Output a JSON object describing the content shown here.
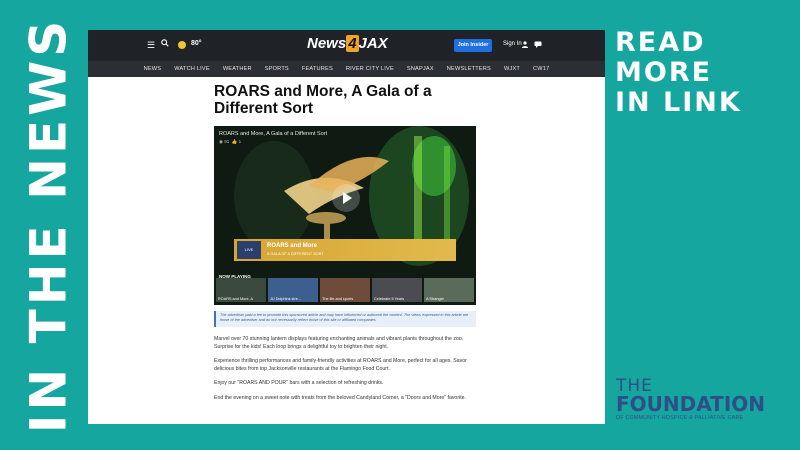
{
  "side_title": "IN THE NEWS",
  "cta_lines": [
    "READ",
    "MORE",
    "IN LINK"
  ],
  "foundation": {
    "the": "THE",
    "name": "FOUNDATION",
    "tagline": "OF COMMUNITY HOSPICE & PALLIATIVE CARE"
  },
  "site": {
    "logo_pre": "News",
    "logo_num": "4",
    "logo_post": "JAX",
    "temperature": "80°",
    "join_label": "Join Insider",
    "signin_label": "Sign In",
    "nav": [
      "NEWS",
      "WATCH LIVE",
      "WEATHER",
      "SPORTS",
      "FEATURES",
      "RIVER CITY LIVE",
      "SNAPJAX",
      "NEWSLETTERS",
      "WJXT",
      "CW17"
    ]
  },
  "article": {
    "headline": "ROARS and More, A Gala of a Different Sort",
    "video": {
      "title": "ROARS and More, A Gala of a Different Sort",
      "views": "91",
      "likes": "1",
      "lower_third_live": "LIVE",
      "lower_third_title": "ROARS and More",
      "lower_third_sub": "A GALA OF A DIFFERENT SORT",
      "now_playing": "NOW PLAYING",
      "thumbs": [
        "ROARS and More, A",
        "JU Dolphins stre...",
        "The life and sports",
        "Celebrate 5 Years",
        "A Stranger"
      ]
    },
    "disclaimer": "The advertiser paid a fee to promote this sponsored article and may have influenced or authored the content. The views expressed in this article are those of the advertiser and do not necessarily reflect those of this site or affiliated companies.",
    "paragraphs": [
      "Marvel over 70 stunning lantern displays featuring enchanting animals and vibrant plants throughout the zoo. Surprise for the kids! Each loop brings a delightful toy to brighten their night.",
      "Experience thrilling performances and family-friendly activities at ROARS and More, perfect for all ages. Savor delicious bites from top Jacksonville restaurants at the Flamingo Food Court.",
      "Enjoy our \"ROARS AND POUR\" bars with a selection of refreshing drinks.",
      "End the evening on a sweet note with treats from the beloved Candyland Corner, a \"Doors and More\" favorite."
    ]
  },
  "colors": {
    "background": "#16a6a0",
    "foundation_text": "#2d4f86",
    "site_bar": "#1f2328",
    "join_button": "#1f6fe0"
  }
}
